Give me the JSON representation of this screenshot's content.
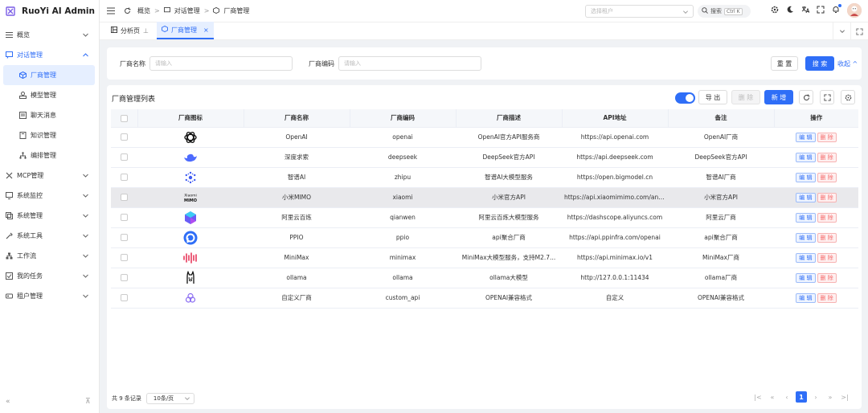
{
  "app": {
    "title": "RuoYi AI Admin"
  },
  "sidebar": {
    "items": [
      {
        "label": "概览",
        "icon": "grid-icon"
      },
      {
        "label": "对话管理",
        "icon": "chat-icon"
      },
      {
        "label": "厂商管理",
        "icon": "cube-icon"
      },
      {
        "label": "模型管理",
        "icon": "model-icon"
      },
      {
        "label": "聊天消息",
        "icon": "message-icon"
      },
      {
        "label": "知识管理",
        "icon": "book-icon"
      },
      {
        "label": "编排管理",
        "icon": "flow-icon"
      },
      {
        "label": "MCP管理",
        "icon": "plug-icon"
      },
      {
        "label": "系统监控",
        "icon": "monitor-icon"
      },
      {
        "label": "系统管理",
        "icon": "system-icon"
      },
      {
        "label": "系统工具",
        "icon": "tool-icon"
      },
      {
        "label": "工作流",
        "icon": "workflow-icon"
      },
      {
        "label": "我的任务",
        "icon": "task-icon"
      },
      {
        "label": "租户管理",
        "icon": "tenant-icon"
      }
    ]
  },
  "breadcrumb": {
    "items": [
      "概览",
      "对话管理",
      "厂商管理"
    ]
  },
  "topbar": {
    "tenant_placeholder": "选择租户",
    "search_label": "搜索",
    "search_shortcut": "Ctrl K"
  },
  "tabs": {
    "items": [
      "分析页",
      "厂商管理"
    ]
  },
  "filter": {
    "name_label": "厂商名称",
    "name_placeholder": "请输入",
    "code_label": "厂商编码",
    "code_placeholder": "请输入",
    "reset": "重 置",
    "search": "搜 索",
    "collapse": "收起"
  },
  "list": {
    "title": "厂商管理列表",
    "export": "导 出",
    "delete": "删 除",
    "add": "新 增",
    "columns": [
      "厂商图标",
      "厂商名称",
      "厂商编码",
      "厂商描述",
      "API地址",
      "备注",
      "操作"
    ],
    "edit_label": "编 辑",
    "delete_label": "删 除",
    "rows": [
      {
        "icon": "openai-logo",
        "name": "OpenAI",
        "code": "openai",
        "desc": "OpenAI官方API服务商",
        "api": "https://api.openai.com",
        "remark": "OpenAI厂商"
      },
      {
        "icon": "deepseek-logo",
        "name": "深度求索",
        "code": "deepseek",
        "desc": "DeepSeek官方API",
        "api": "https://api.deepseek.com",
        "remark": "DeepSeek官方API"
      },
      {
        "icon": "zhipu-logo",
        "name": "智谱AI",
        "code": "zhipu",
        "desc": "智谱AI大模型服务",
        "api": "https://open.bigmodel.cn",
        "remark": "智谱AI厂商"
      },
      {
        "icon": "xiaomi-mimo-logo",
        "name": "小米MIMO",
        "code": "xiaomi",
        "desc": "小米官方API",
        "api": "https://api.xiaomimimo.com/anth...",
        "remark": "小米官方API"
      },
      {
        "icon": "qianwen-logo",
        "name": "阿里云百炼",
        "code": "qianwen",
        "desc": "阿里云百炼大模型服务",
        "api": "https://dashscope.aliyuncs.com",
        "remark": "阿里云厂商"
      },
      {
        "icon": "ppio-logo",
        "name": "PPIO",
        "code": "ppio",
        "desc": "api聚合厂商",
        "api": "https://api.ppinfra.com/openai",
        "remark": "api聚合厂商"
      },
      {
        "icon": "minimax-logo",
        "name": "MiniMax",
        "code": "minimax",
        "desc": "MiniMax大模型服务，支持M2.7...",
        "api": "https://api.minimax.io/v1",
        "remark": "MiniMax厂商"
      },
      {
        "icon": "ollama-logo",
        "name": "ollama",
        "code": "ollama",
        "desc": "ollama大模型",
        "api": "http://127.0.0.1:11434",
        "remark": "ollama厂商"
      },
      {
        "icon": "custom-api-logo",
        "name": "自定义厂商",
        "code": "custom_api",
        "desc": "OPENAI兼容格式",
        "api": "自定义",
        "remark": "OPENAI兼容格式"
      }
    ]
  },
  "pager": {
    "total": "共 9 条记录",
    "size": "10条/页",
    "current": "1"
  },
  "colors": {
    "primary": "#2f6ef7",
    "danger": "#f56c6c"
  }
}
